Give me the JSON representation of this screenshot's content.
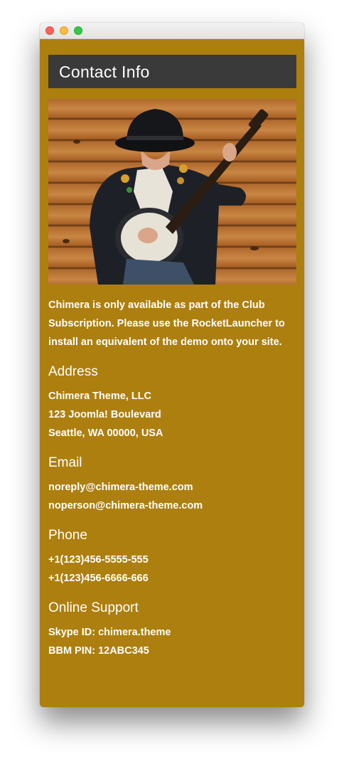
{
  "heading": "Contact Info",
  "intro": "Chimera is only available as part of the Club Subscription. Please use the RocketLauncher to install an equivalent of the demo onto your site.",
  "sections": [
    {
      "title": "Address",
      "lines": [
        "Chimera Theme, LLC",
        "123 Joomla! Boulevard",
        "Seattle, WA 00000, USA"
      ]
    },
    {
      "title": "Email",
      "lines": [
        "noreply@chimera-theme.com",
        "noperson@chimera-theme.com"
      ]
    },
    {
      "title": "Phone",
      "lines": [
        "+1(123)456-5555-555",
        "+1(123)456-6666-666"
      ]
    },
    {
      "title": "Online Support",
      "lines": [
        "Skype ID: chimera.theme",
        "BBM PIN: 12ABC345"
      ]
    }
  ],
  "colors": {
    "background": "#ad7f0f",
    "heading_bar": "#3a3a3a",
    "text": "#ffffff"
  }
}
